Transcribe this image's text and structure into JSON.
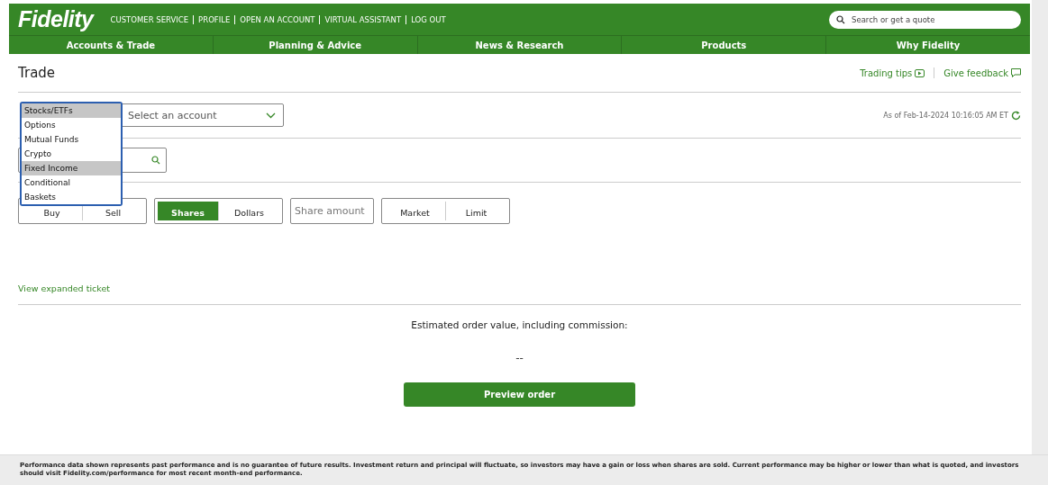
{
  "header": {
    "logo": "Fidelity",
    "links": [
      "CUSTOMER SERVICE",
      "PROFILE",
      "OPEN AN ACCOUNT",
      "VIRTUAL ASSISTANT",
      "LOG OUT"
    ],
    "search": {
      "placeholder": "Search or get a quote"
    }
  },
  "nav": [
    "Accounts & Trade",
    "Planning & Advice",
    "News & Research",
    "Products",
    "Why Fidelity"
  ],
  "page": {
    "title": "Trade",
    "links": [
      "Trading tips",
      "Give feedback"
    ],
    "timestamp": "As of Feb-14-2024 10:16:05 AM ET"
  },
  "trade_type_dropdown": {
    "options": [
      {
        "label": "Stocks/ETFs",
        "selected": true
      },
      {
        "label": "Options",
        "selected": false
      },
      {
        "label": "Mutual Funds",
        "selected": false
      },
      {
        "label": "Crypto",
        "selected": false
      },
      {
        "label": "Fixed Income",
        "selected": true
      },
      {
        "label": "Conditional",
        "selected": false
      },
      {
        "label": "Baskets",
        "selected": false
      }
    ]
  },
  "account_select": {
    "placeholder": "Select an account"
  },
  "action": [
    {
      "label": "Buy",
      "selected": false
    },
    {
      "label": "Sell",
      "selected": false
    }
  ],
  "quantity_type": [
    {
      "label": "Shares",
      "selected": true
    },
    {
      "label": "Dollars",
      "selected": false
    }
  ],
  "amount": {
    "placeholder": "Share amount"
  },
  "order_type": [
    {
      "label": "Market",
      "selected": false
    },
    {
      "label": "Limit",
      "selected": false
    }
  ],
  "expanded_link": "View expanded ticket",
  "estimate": {
    "label": "Estimated order value, including commission:",
    "value": "--"
  },
  "preview_button": "Preview order",
  "footer": "Performance data shown represents past performance and is no guarantee of future results. Investment return and principal will fluctuate, so investors may have a gain or loss when shares are sold. Current performance may be higher or lower than what is quoted, and investors should visit Fidelity.com/performance for most recent month-end performance."
}
